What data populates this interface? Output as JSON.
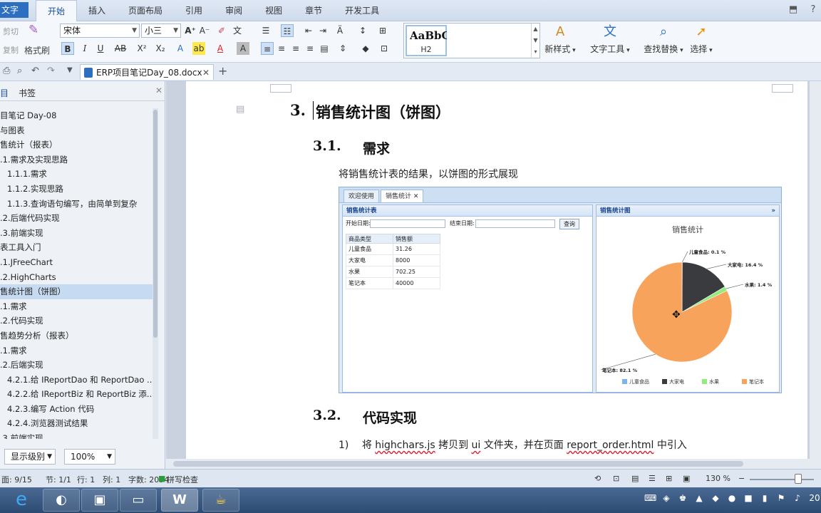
{
  "menubar": {
    "app_menu": "文字",
    "tabs": [
      "开始",
      "插入",
      "页面布局",
      "引用",
      "审阅",
      "视图",
      "章节",
      "开发工具"
    ]
  },
  "ribbon": {
    "cut": "剪切",
    "copy": "复制",
    "format_painter": "格式刷",
    "font_name": "宋体",
    "font_size": "小三",
    "style_sample": "AaBbC",
    "style_name": "H2",
    "new_style": "新样式",
    "text_tools": "文字工具",
    "find_replace": "查找替换",
    "select": "选择"
  },
  "doc_tab": {
    "filename": "ERP项目笔记Day_08.docx"
  },
  "nav": {
    "tab_outline": "目",
    "tab_bookmarks": "书签",
    "items": [
      "目笔记 Day-08",
      "与图表",
      "售统计（报表）",
      ".1.需求及实现思路",
      "1.1.1.需求",
      "1.1.2.实现思路",
      "1.1.3.查询语句编写，由简单到复杂",
      ".2.后端代码实现",
      ".3.前端实现",
      "表工具入门",
      ".1.JFreeChart",
      ".2.HighCharts",
      "售统计图（饼图）",
      ".1.需求",
      ".2.代码实现",
      "售趋势分析（报表）",
      ".1.需求",
      ".2.后端实现",
      "4.2.1.给 IReportDao 和 ReportDao ...",
      "4.2.2.给 IReportBiz 和 ReportBiz 添...",
      "4.2.3.编写 Action 代码",
      "4.2.4.浏览器测试结果",
      ".3.前端实现"
    ],
    "selected_index": 12,
    "level_select": "显示级别",
    "zoom_select": "100%"
  },
  "document": {
    "heading1_num": "3.",
    "heading1_text": "销售统计图（饼图）",
    "h2a_num": "3.1.",
    "h2a_text": "需求",
    "para1": "将销售统计表的结果，以饼图的形式展现",
    "h2b_num": "3.2.",
    "h2b_text": "代码实现",
    "step_num": "1)",
    "step_pre": "将",
    "step_file": "highchars.js",
    "step_mid1": "拷贝到",
    "step_dir": "ui",
    "step_mid2": "文件夹，并在页面",
    "step_page": "report_order.html",
    "step_post": "中引入"
  },
  "screenshot": {
    "tab_welcome": "欢迎使用",
    "tab_sales": "销售统计",
    "left_title": "销售统计表",
    "start_label": "开始日期:",
    "end_label": "结束日期:",
    "query_button": "查询",
    "col_type": "商品类型",
    "col_amount": "销售额",
    "rows": [
      {
        "name": "儿童食品",
        "value": "31.26"
      },
      {
        "name": "大家电",
        "value": "8000"
      },
      {
        "name": "水果",
        "value": "702.25"
      },
      {
        "name": "笔记本",
        "value": "40000"
      }
    ],
    "right_title": "销售统计图"
  },
  "chart_data": {
    "type": "pie",
    "title": "销售统计",
    "slices": [
      {
        "name": "儿童食品",
        "value": 0.1,
        "label": "儿童食品: 0.1 %",
        "color": "#7cb5ec"
      },
      {
        "name": "大家电",
        "value": 16.4,
        "label": "大家电: 16.4 %",
        "color": "#3a3b3f"
      },
      {
        "name": "水果",
        "value": 1.4,
        "label": "水果: 1.4 %",
        "color": "#90ed7d"
      },
      {
        "name": "笔记本",
        "value": 82.1,
        "label": "笔记本: 82.1 %",
        "color": "#f7a35c"
      }
    ],
    "legend": [
      "儿童食品",
      "大家电",
      "水果",
      "笔记本"
    ],
    "legend_position": "bottom"
  },
  "status": {
    "page": "面: 9/15",
    "section": "节: 1/1",
    "line": "行: 1",
    "col": "列: 1",
    "words": "字数: 2094",
    "spell": "拼写检查",
    "zoom": "130 %"
  },
  "colors": {
    "accent": "#2c6fc0",
    "nav_selected": "#c6daf2"
  }
}
